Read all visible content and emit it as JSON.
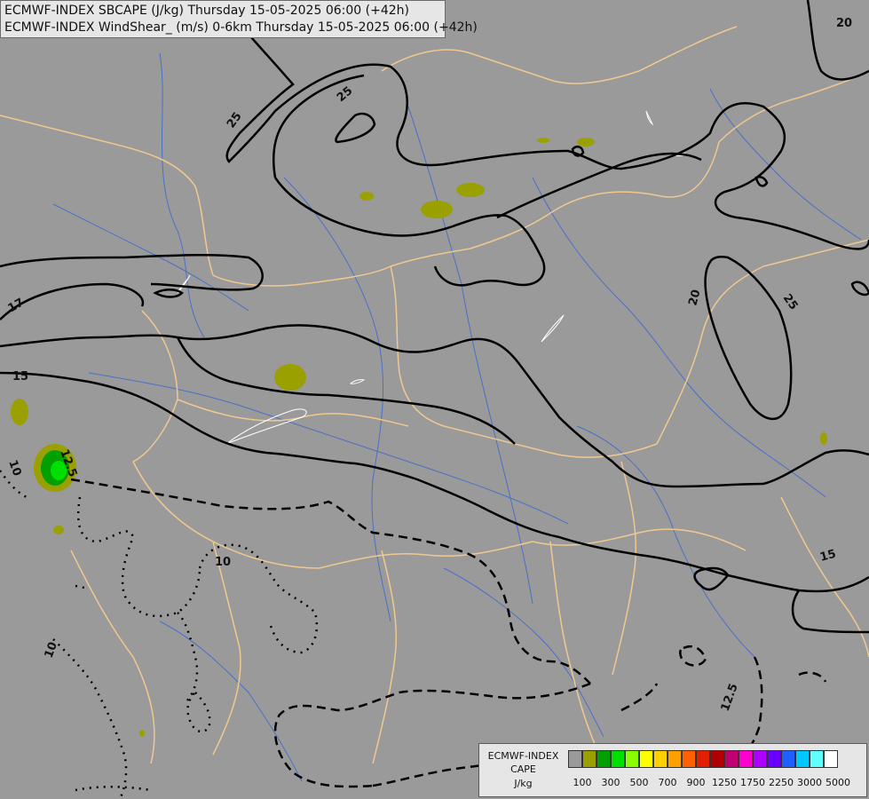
{
  "title": {
    "line1": "ECMWF-INDEX SBCAPE (J/kg) Thursday 15-05-2025 06:00 (+42h)",
    "line2": "ECMWF-INDEX WindShear_ (m/s) 0-6km Thursday 15-05-2025 06:00 (+42h)"
  },
  "legend": {
    "line1": "ECMWF-INDEX",
    "line2": "CAPE",
    "line3": "J/kg",
    "colors": [
      "#9a9a9a",
      "#9aa000",
      "#00a000",
      "#00e000",
      "#8aff00",
      "#ffff00",
      "#ffd000",
      "#ffa000",
      "#ff6000",
      "#e02000",
      "#b00000",
      "#c00070",
      "#ff00d0",
      "#b000ff",
      "#6a00ff",
      "#2060ff",
      "#00c8ff",
      "#60ffff",
      "#ffffff"
    ],
    "tick_labels": [
      "100",
      "300",
      "500",
      "700",
      "900",
      "1250",
      "1750",
      "2250",
      "3000",
      "5000"
    ]
  },
  "map": {
    "background": "#9a9a9a",
    "border_color": "#f0c890",
    "river_color": "#4a70c8",
    "contour_color": "#000000",
    "cape_fill_100": "#9aa000",
    "cape_fill_300": "#00a000",
    "cape_fill_500": "#00e000",
    "contour_labels": [
      "25",
      "25",
      "20",
      "20",
      "17",
      "15",
      "15",
      "12.5",
      "12.5",
      "10",
      "10",
      "10",
      "25",
      "20"
    ]
  }
}
